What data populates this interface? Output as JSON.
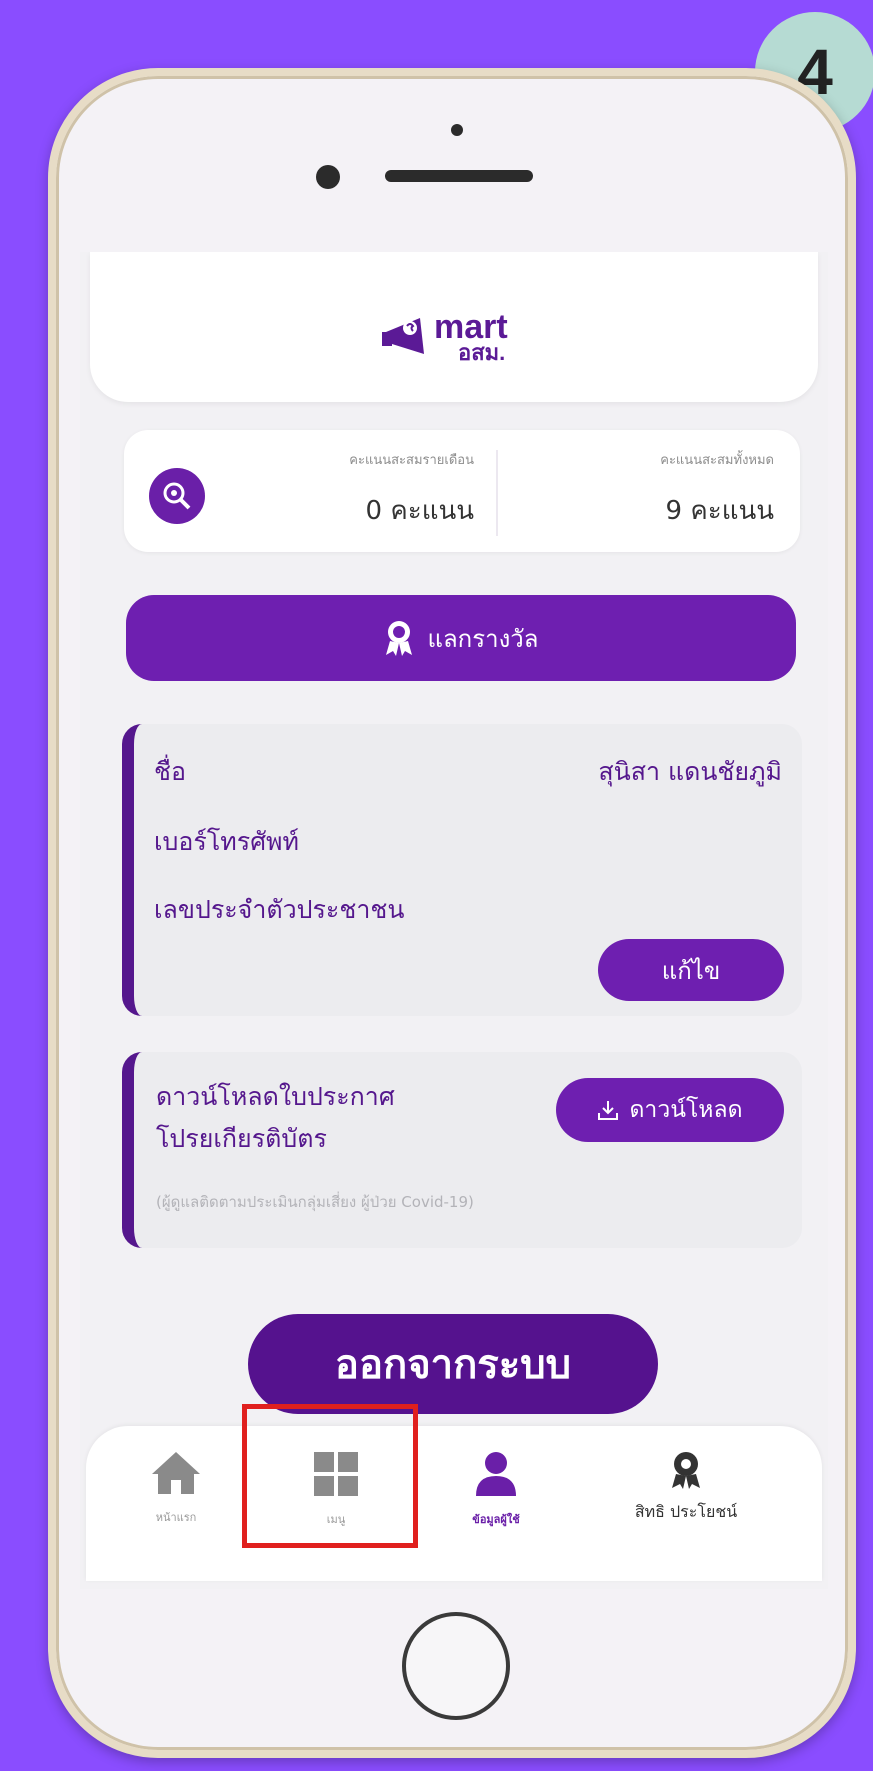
{
  "step_badge": "4",
  "header": {
    "logo_word": "mart",
    "logo_sub": "อสม."
  },
  "points": {
    "monthly_caption": "คะแนนสะสมรายเดือน",
    "monthly_value": "0 คะแนน",
    "total_caption": "คะแนนสะสมทั้งหมด",
    "total_value": "9 คะแนน"
  },
  "reward_button": {
    "label": "แลกรางวัล",
    "icon": "award-ribbon-icon"
  },
  "profile": {
    "name_label": "ชื่อ",
    "name_value": "สุนิสา แดนชัยภูมิ",
    "phone_label": "เบอร์โทรศัพท์",
    "id_label": "เลขประจำตัวประชาชน",
    "edit_label": "แก้ไข"
  },
  "download_card": {
    "title": "ดาวน์โหลดใบประกาศ โปรยเกียรติบัตร",
    "note": "(ผู้ดูแลติดตามประเมินกลุ่มเสี่ยง ผู้ป่วย Covid-19)",
    "button_label": "ดาวน์โหลด",
    "button_icon": "download-icon"
  },
  "logout_label": "ออกจากระบบ",
  "bottom_nav": {
    "items": [
      {
        "label": "หน้าแรก",
        "icon": "home-icon"
      },
      {
        "label": "เมนู",
        "icon": "grid-menu-icon"
      },
      {
        "label": "ข้อมูลผู้ใช้",
        "icon": "user-icon"
      },
      {
        "label": "สิทธิ ประโยชน์",
        "icon": "award-ribbon-icon"
      }
    ]
  },
  "colors": {
    "background": "#8a4dff",
    "accent": "#6e1fb0",
    "highlight": "#e0201e"
  }
}
